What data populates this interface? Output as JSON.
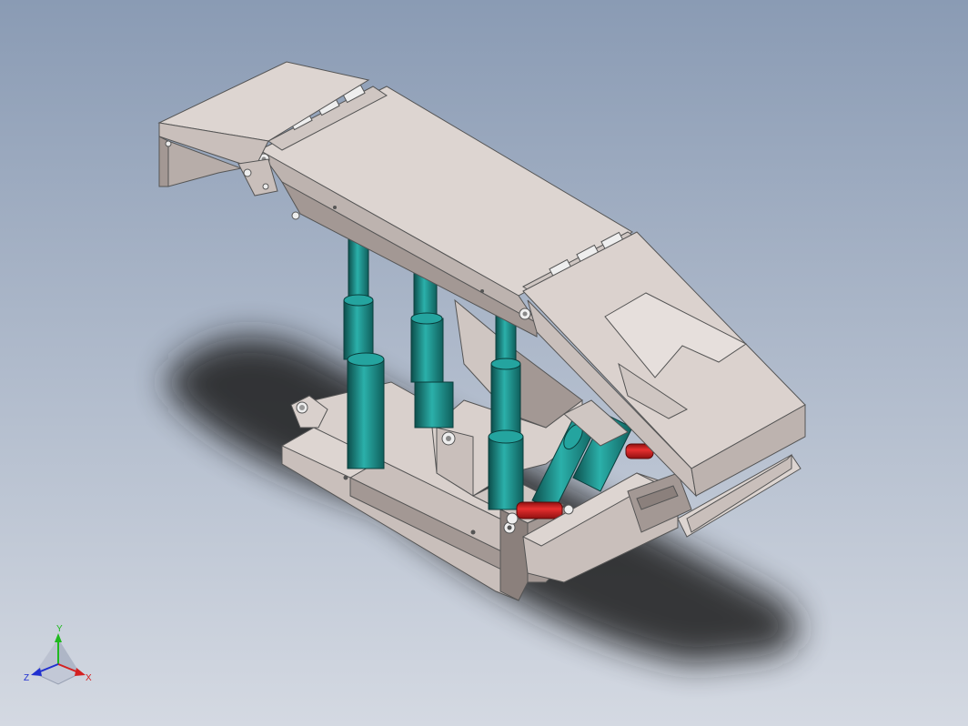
{
  "viewport": {
    "background_top": "#8a9bb4",
    "background_bottom": "#d4d9e2"
  },
  "model": {
    "metal_color": "#d9d0cc",
    "metal_shade": "#a39894",
    "metal_dark": "#7a706c",
    "cylinder_color": "#1f9a96",
    "cylinder_dark": "#0f5f5c",
    "rod_color": "#d42020"
  },
  "triad": {
    "x_label": "X",
    "y_label": "Y",
    "z_label": "Z",
    "x_color": "#d42020",
    "y_color": "#1fb91f",
    "z_color": "#2030d0"
  }
}
